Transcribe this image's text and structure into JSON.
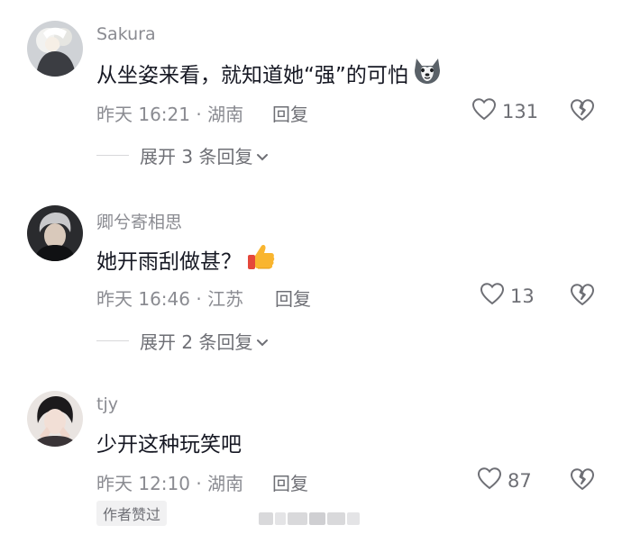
{
  "comments": [
    {
      "username": "Sakura",
      "text": "从坐姿来看，就知道她“强”的可怕",
      "emoji": "husky-dog-emoji",
      "time": "昨天 16:21",
      "location": "湖南",
      "reply_label": "回复",
      "likes": "131",
      "expand_label": "展开 3 条回复"
    },
    {
      "username": "卿兮寄相思",
      "text": "她开雨刮做甚？",
      "emoji": "thumbs-up-emoji",
      "time": "昨天 16:46",
      "location": "江苏",
      "reply_label": "回复",
      "likes": "13",
      "expand_label": "展开 2 条回复"
    },
    {
      "username": "tjy",
      "text": "少开这种玩笑吧",
      "time": "昨天 12:10",
      "location": "湖南",
      "reply_label": "回复",
      "likes": "87",
      "badge": "作者赞过"
    }
  ],
  "meta_separator": " · ",
  "icons": {
    "like": "heart-outline-icon",
    "dislike": "broken-heart-icon",
    "expand": "chevron-down-icon"
  },
  "colors": {
    "primary_text": "#161823",
    "secondary_text": "#8a8b91",
    "action_text": "#6e6f75"
  }
}
